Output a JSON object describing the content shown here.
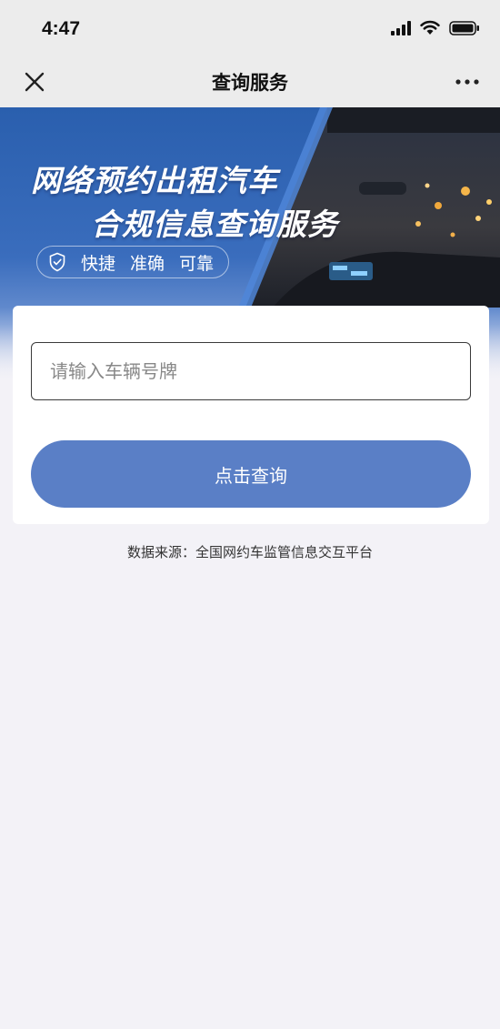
{
  "status": {
    "time": "4:47",
    "icons": [
      "signal-icon",
      "wifi-icon",
      "battery-icon"
    ]
  },
  "nav": {
    "close_icon": "close-icon",
    "title": "查询服务",
    "more_icon": "more-icon"
  },
  "banner": {
    "title_line1": "网络预约出租汽车",
    "title_line2": "合规信息查询服务",
    "tags": [
      "快捷",
      "准确",
      "可靠"
    ],
    "shield_icon": "shield-check-icon"
  },
  "form": {
    "plate_placeholder": "请输入车辆号牌",
    "plate_value": "",
    "submit_label": "点击查询"
  },
  "footer": {
    "source": "数据来源：全国网约车监管信息交互平台"
  },
  "colors": {
    "banner_blue": "#2a5fae",
    "button_blue": "#5a7fc6",
    "background": "#f3f2f7"
  }
}
